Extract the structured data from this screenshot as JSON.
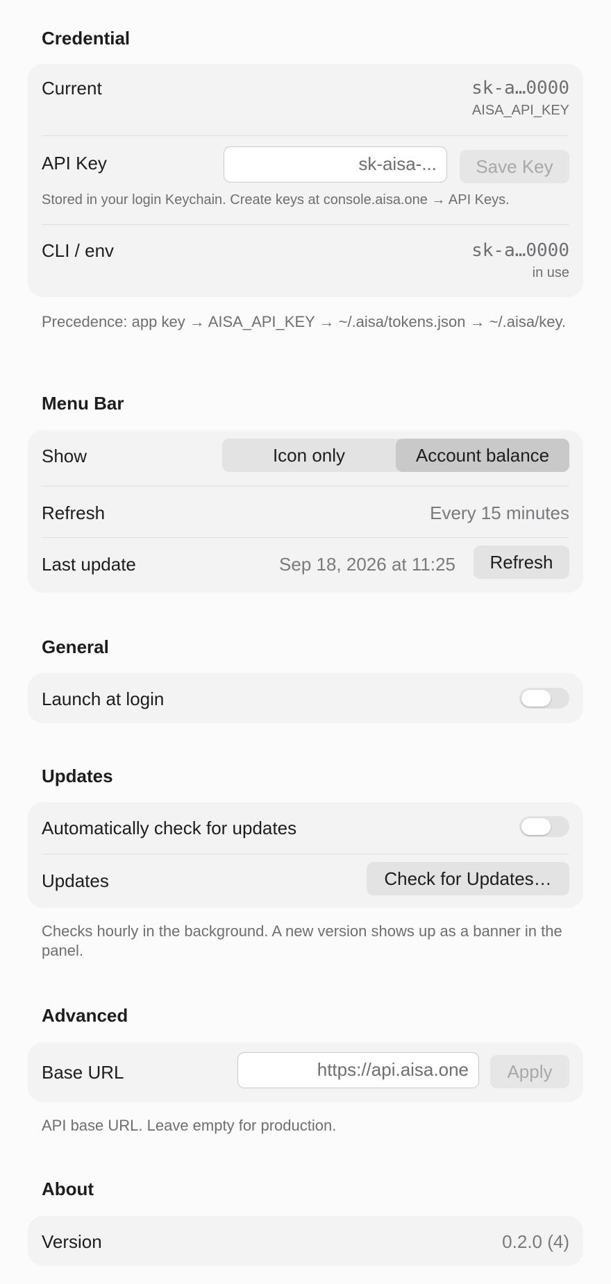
{
  "credential": {
    "title": "Credential",
    "current_label": "Current",
    "current_value": "sk-a…0000",
    "current_source": "AISA_API_KEY",
    "api_key_label": "API Key",
    "api_key_placeholder": "sk-aisa-...",
    "save_key_label": "Save Key",
    "keychain_note": "Stored in your login Keychain. Create keys at console.aisa.one → API Keys.",
    "cli_label": "CLI / env",
    "cli_value": "sk-a…0000",
    "cli_status": "in use",
    "precedence_note": "Precedence: app key → AISA_API_KEY → ~/.aisa/tokens.json → ~/.aisa/key."
  },
  "menu_bar": {
    "title": "Menu Bar",
    "show_label": "Show",
    "show_options": [
      "Icon only",
      "Account balance"
    ],
    "show_selected": "Account balance",
    "refresh_label": "Refresh",
    "refresh_value": "Every 15 minutes",
    "last_update_label": "Last update",
    "last_update_value": "Sep 18, 2026 at 11:25",
    "refresh_button_label": "Refresh"
  },
  "general": {
    "title": "General",
    "launch_label": "Launch at login",
    "launch_enabled": false
  },
  "updates": {
    "title": "Updates",
    "auto_check_label": "Automatically check for updates",
    "auto_check_enabled": false,
    "updates_label": "Updates",
    "check_button_label": "Check for Updates…",
    "note": "Checks hourly in the background. A new version shows up as a banner in the panel."
  },
  "advanced": {
    "title": "Advanced",
    "base_url_label": "Base URL",
    "base_url_value": "https://api.aisa.one",
    "apply_label": "Apply",
    "note": "API base URL. Leave empty for production."
  },
  "about": {
    "title": "About",
    "version_label": "Version",
    "version_value": "0.2.0 (4)"
  }
}
